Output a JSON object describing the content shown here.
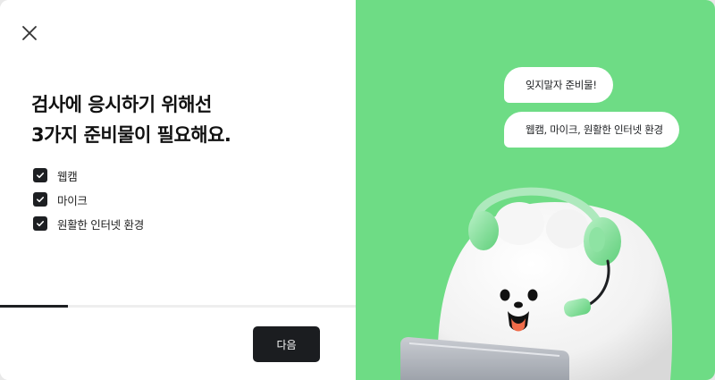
{
  "modal": {
    "close_icon": "close-icon",
    "headline": {
      "line1": "검사에 응시하기 위해선",
      "line2": "3가지 준비물이 필요해요."
    },
    "checklist": [
      {
        "label": "웹캠",
        "checked": true
      },
      {
        "label": "마이크",
        "checked": true
      },
      {
        "label": "원활한 인터넷 환경",
        "checked": true
      }
    ],
    "progress": {
      "value": 0.19
    },
    "next_button": {
      "label": "다음"
    }
  },
  "illustration": {
    "bubbles": [
      {
        "text": "잊지말자 준비물!"
      },
      {
        "text": "웹캠, 마이크, 원활한 인터넷 환경"
      }
    ],
    "mascot": "bear-with-headset-and-laptop"
  },
  "colors": {
    "accent_green": "#6edc85",
    "dark": "#1d1f22",
    "white": "#ffffff"
  }
}
